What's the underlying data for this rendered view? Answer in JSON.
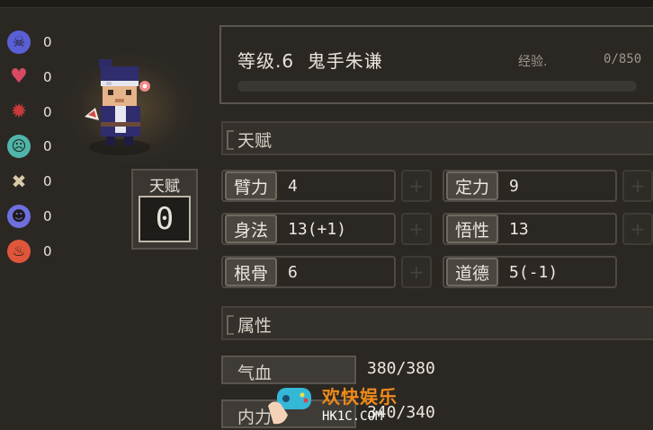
{
  "status_effects": [
    {
      "icon": "skull-icon",
      "value": "0",
      "color": "#5b5fd6"
    },
    {
      "icon": "broken-heart-icon",
      "value": "0",
      "color": "#d84a62"
    },
    {
      "icon": "blood-splat-icon",
      "value": "0",
      "color": "#c93a3a"
    },
    {
      "icon": "sick-face-icon",
      "value": "0",
      "color": "#4fb5a8"
    },
    {
      "icon": "pin-cross-icon",
      "value": "0",
      "color": "#d9c9a8"
    },
    {
      "icon": "angry-face-icon",
      "value": "0",
      "color": "#6f6fe0"
    },
    {
      "icon": "fire-icon",
      "value": "0",
      "color": "#e0563a"
    }
  ],
  "character": {
    "talent_label": "天赋",
    "talent_points": "0"
  },
  "profile": {
    "level_name": "等级.6  鬼手朱谦",
    "exp_label": "经验.",
    "exp_value": "0/850",
    "exp_progress": 0
  },
  "talent_section": {
    "title": "天赋"
  },
  "attributes": [
    {
      "label": "臂力",
      "value": "4"
    },
    {
      "label": "定力",
      "value": "9"
    },
    {
      "label": "身法",
      "value": "13(+1)"
    },
    {
      "label": "悟性",
      "value": "13"
    },
    {
      "label": "根骨",
      "value": "6"
    },
    {
      "label": "道德",
      "value": "5(-1)"
    }
  ],
  "plus_label": "+",
  "property_section": {
    "title": "属性"
  },
  "properties": [
    {
      "label": "气血",
      "value": "380/380"
    },
    {
      "label": "内力",
      "value": "340/340"
    }
  ],
  "watermark": {
    "title": "欢快娱乐",
    "subtitle": "HK1C.COM"
  }
}
